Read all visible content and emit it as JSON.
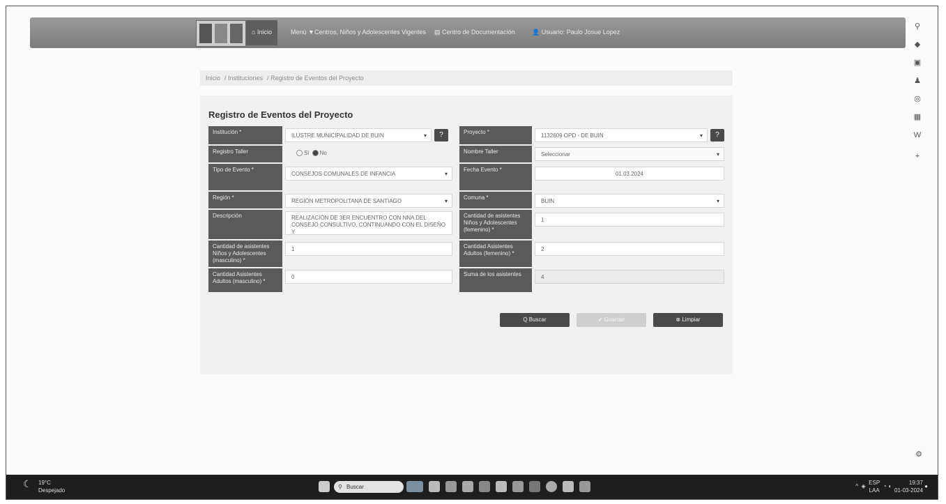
{
  "nav": {
    "home": "Inicio",
    "menu": "Menú ▼",
    "centers": "Centros, Niños y Adolescentes Vigentes",
    "docs": "Centro de Documentación",
    "user": "Usuario: Paulo Josue Lopez"
  },
  "breadcrumb": [
    "Inicio",
    "Instituciones",
    "Registro de Eventos del Proyecto"
  ],
  "form": {
    "title": "Registro de Eventos del Proyecto",
    "institucion_label": "Institución *",
    "institucion_value": "ILUSTRE MUNICIPALIDAD DE BUIN",
    "proyecto_label": "Proyecto *",
    "proyecto_value": "1132609 OPD - DE BUIN",
    "registro_taller_label": "Registro Taller",
    "radio_si": "Si",
    "radio_no": "No",
    "nombre_taller_label": "Nombre Taller",
    "nombre_taller_value": "Seleccionar",
    "tipo_evento_label": "Tipo de Evento *",
    "tipo_evento_value": "CONSEJOS COMUNALES DE INFANCIA",
    "fecha_evento_label": "Fecha Evento *",
    "fecha_evento_value": "01.03.2024",
    "region_label": "Región *",
    "region_value": "REGIÓN METROPOLITANA DE SANTIAGO",
    "comuna_label": "Comuna *",
    "comuna_value": "BUIN",
    "descripcion_label": "Descripción",
    "descripcion_value": "REALIZACIÓN DE 3ER ENCUENTRO CON NNA DEL CONSEJO CONSULTIVO, CONTINUANDO CON EL DISEÑO Y",
    "cant_nna_fem_label": "Cantidad de asistentes Niños y Adolescentes (femenino) *",
    "cant_nna_fem_value": "1",
    "cant_nna_masc_label": "Cantidad de asistentes Niños y Adolescentes (masculino) *",
    "cant_nna_masc_value": "1",
    "cant_adultos_fem_label": "Cantidad Asistentes Adultos (femenino) *",
    "cant_adultos_fem_value": "2",
    "cant_adultos_masc_label": "Cantidad Asistentes Adultos (masculino) *",
    "cant_adultos_masc_value": "0",
    "suma_label": "Suma de los asistentes",
    "suma_value": "4"
  },
  "actions": {
    "buscar": "Q Buscar",
    "guardar": "✔ Guardar",
    "limpiar": "⊗ Limpiar"
  },
  "taskbar": {
    "temp": "19°C",
    "weather": "Despejado",
    "search_placeholder": "Buscar",
    "lang": "ESP",
    "lang2": "LAA",
    "time": "19:37",
    "date": "01-03-2024"
  }
}
